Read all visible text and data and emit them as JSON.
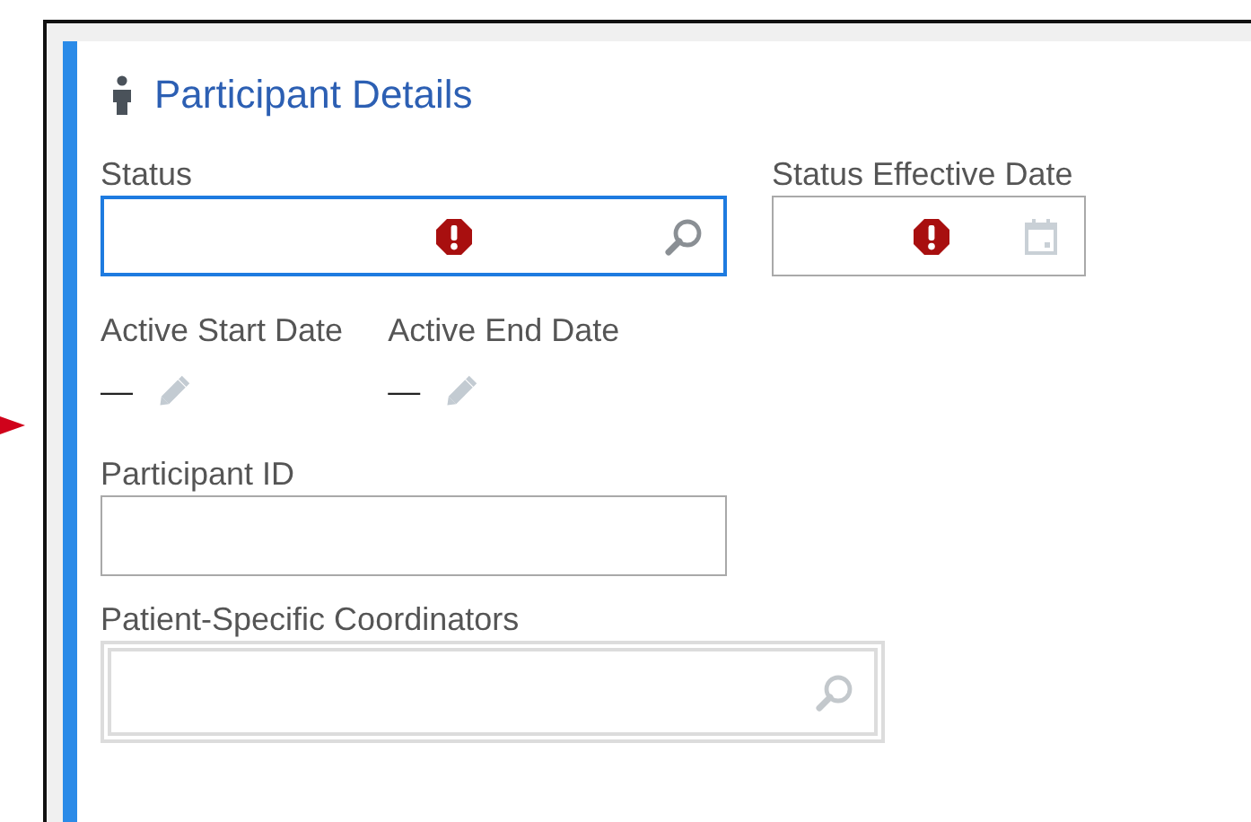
{
  "section": {
    "title": "Participant Details"
  },
  "rows": [
    {
      "fields": [
        {
          "kind": "lookup",
          "label": "Status",
          "focused": true,
          "error": true
        },
        {
          "kind": "date",
          "label": "Status Effective Date",
          "focused": false,
          "error": true
        }
      ]
    },
    {
      "fields": [
        {
          "kind": "readonly",
          "label": "Active Start Date",
          "value": "—"
        },
        {
          "kind": "readonly",
          "label": "Active End Date",
          "value": "—"
        }
      ]
    },
    {
      "fields": [
        {
          "kind": "text",
          "label": "Participant ID",
          "focused": false,
          "error": false
        }
      ]
    },
    {
      "fields": [
        {
          "kind": "multi-lookup",
          "label": "Patient-Specific Coordinators",
          "focused": false,
          "error": false
        }
      ]
    }
  ]
}
